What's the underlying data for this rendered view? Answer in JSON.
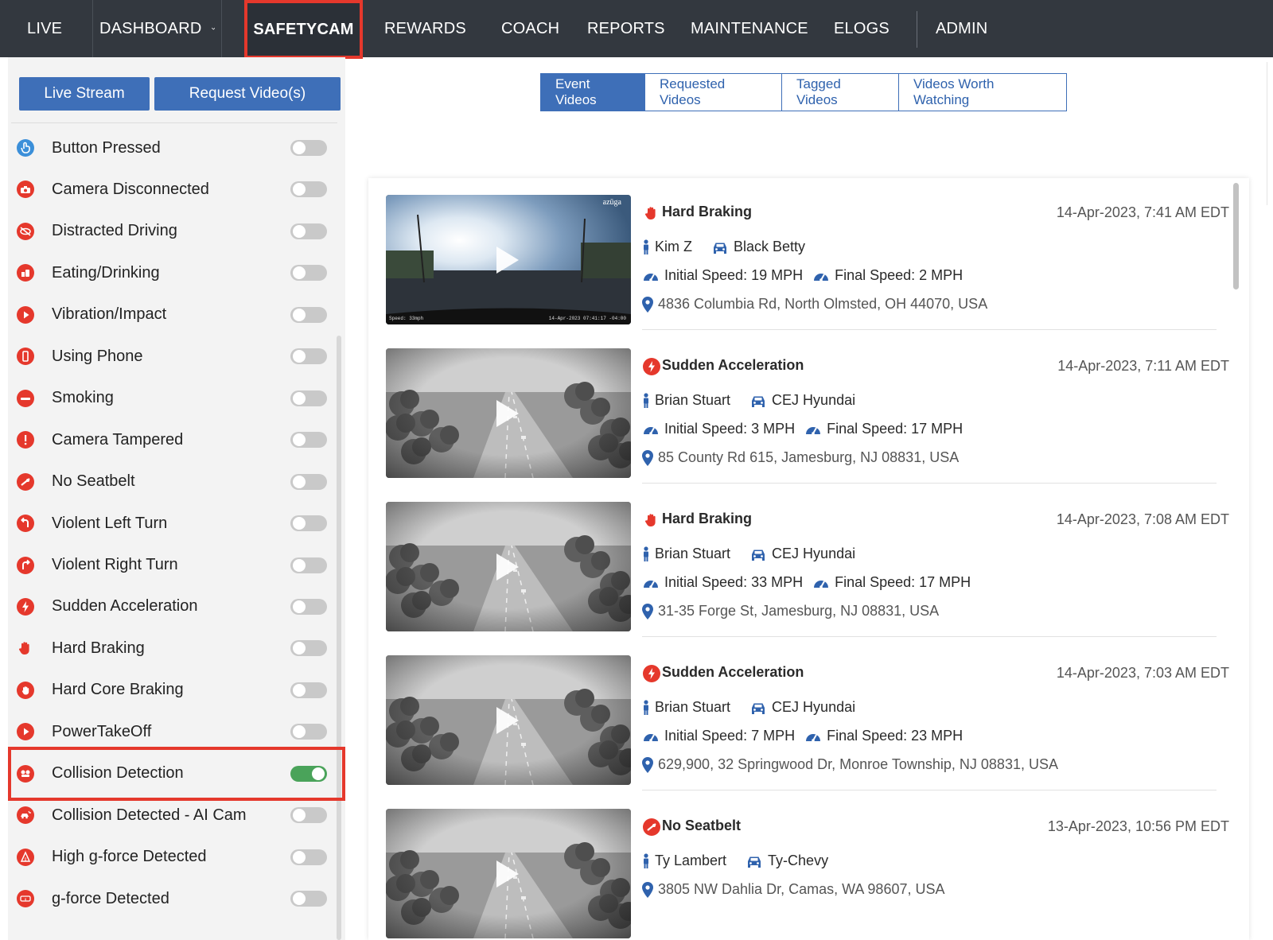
{
  "nav": {
    "items": [
      {
        "label": "LIVE"
      },
      {
        "label": "DASHBOARD"
      },
      {
        "label": "SAFETYCAM"
      },
      {
        "label": "REWARDS"
      },
      {
        "label": "COACH"
      },
      {
        "label": "REPORTS"
      },
      {
        "label": "MAINTENANCE"
      },
      {
        "label": "ELOGS"
      },
      {
        "label": "ADMIN"
      }
    ],
    "active": "SAFETYCAM",
    "highlight_color": "#e5382c"
  },
  "sidebar": {
    "live_stream_label": "Live Stream",
    "request_video_label": "Request Video(s)",
    "filters": [
      {
        "label": "Button Pressed",
        "icon": "hand-pointer-icon",
        "enabled": false
      },
      {
        "label": "Camera Disconnected",
        "icon": "camera-icon",
        "enabled": false
      },
      {
        "label": "Distracted Driving",
        "icon": "eye-slash-icon",
        "enabled": false
      },
      {
        "label": "Eating/Drinking",
        "icon": "food-icon",
        "enabled": false
      },
      {
        "label": "Vibration/Impact",
        "icon": "play-circle-icon",
        "enabled": false
      },
      {
        "label": "Using Phone",
        "icon": "phone-icon",
        "enabled": false
      },
      {
        "label": "Smoking",
        "icon": "smoking-icon",
        "enabled": false
      },
      {
        "label": "Camera Tampered",
        "icon": "exclamation-icon",
        "enabled": false
      },
      {
        "label": "No Seatbelt",
        "icon": "seatbelt-icon",
        "enabled": false
      },
      {
        "label": "Violent Left Turn",
        "icon": "left-turn-icon",
        "enabled": false
      },
      {
        "label": "Violent Right Turn",
        "icon": "right-turn-icon",
        "enabled": false
      },
      {
        "label": "Sudden Acceleration",
        "icon": "bolt-icon",
        "enabled": false
      },
      {
        "label": "Hard Braking",
        "icon": "hand-stop-icon",
        "enabled": false
      },
      {
        "label": "Hard Core Braking",
        "icon": "hand-stop-circle-icon",
        "enabled": false
      },
      {
        "label": "PowerTakeOff",
        "icon": "play-circle-icon",
        "enabled": false
      },
      {
        "label": "Collision Detection",
        "icon": "collision-icon",
        "enabled": true
      },
      {
        "label": "Collision Detected - AI Cam",
        "icon": "car-crash-icon",
        "enabled": false
      },
      {
        "label": "High g-force Detected",
        "icon": "gforce-high-icon",
        "enabled": false
      },
      {
        "label": "g-force Detected",
        "icon": "gforce-icon",
        "enabled": false
      }
    ]
  },
  "tabs": [
    {
      "label": "Event Videos",
      "active": true
    },
    {
      "label": "Requested Videos",
      "active": false
    },
    {
      "label": "Tagged Videos",
      "active": false
    },
    {
      "label": "Videos Worth Watching",
      "active": false
    }
  ],
  "events": [
    {
      "title": "Hard Braking",
      "icon": "hand-stop-icon",
      "time": "14-Apr-2023, 7:41 AM EDT",
      "driver": "Kim Z",
      "vehicle": "Black Betty",
      "initial_speed": "Initial Speed: 19 MPH",
      "final_speed": "Final Speed: 2 MPH",
      "address": "4836 Columbia Rd, North Olmsted, OH 44070, USA",
      "thumb": "dashcam",
      "brand": "azūga",
      "overlay_speed": "Speed: 33mph",
      "overlay_time": "14-Apr-2023 07:41:17 -04:00"
    },
    {
      "title": "Sudden Acceleration",
      "icon": "bolt-icon",
      "time": "14-Apr-2023, 7:11 AM EDT",
      "driver": "Brian Stuart",
      "vehicle": "CEJ Hyundai",
      "initial_speed": "Initial Speed: 3 MPH",
      "final_speed": "Final Speed: 17 MPH",
      "address": "85 County Rd 615, Jamesburg, NJ 08831, USA",
      "thumb": "highway"
    },
    {
      "title": "Hard Braking",
      "icon": "hand-stop-icon",
      "time": "14-Apr-2023, 7:08 AM EDT",
      "driver": "Brian Stuart",
      "vehicle": "CEJ Hyundai",
      "initial_speed": "Initial Speed: 33 MPH",
      "final_speed": "Final Speed: 17 MPH",
      "address": "31-35 Forge St, Jamesburg, NJ 08831, USA",
      "thumb": "highway"
    },
    {
      "title": "Sudden Acceleration",
      "icon": "bolt-icon",
      "time": "14-Apr-2023, 7:03 AM EDT",
      "driver": "Brian Stuart",
      "vehicle": "CEJ Hyundai",
      "initial_speed": "Initial Speed: 7 MPH",
      "final_speed": "Final Speed: 23 MPH",
      "address": "629,900, 32 Springwood Dr, Monroe Township, NJ 08831, USA",
      "thumb": "highway"
    },
    {
      "title": "No Seatbelt",
      "icon": "seatbelt-icon",
      "time": "13-Apr-2023, 10:56 PM EDT",
      "driver": "Ty Lambert",
      "vehicle": "Ty-Chevy",
      "initial_speed": "",
      "final_speed": "",
      "address": "3805 NW Dahlia Dr, Camas, WA 98607, USA",
      "thumb": "highway"
    }
  ],
  "colors": {
    "nav_bg": "#33383f",
    "primary": "#3e6fb8",
    "alert_red": "#e5382c",
    "toggle_on": "#4aa35a",
    "icon_blue": "#2f62ad"
  }
}
